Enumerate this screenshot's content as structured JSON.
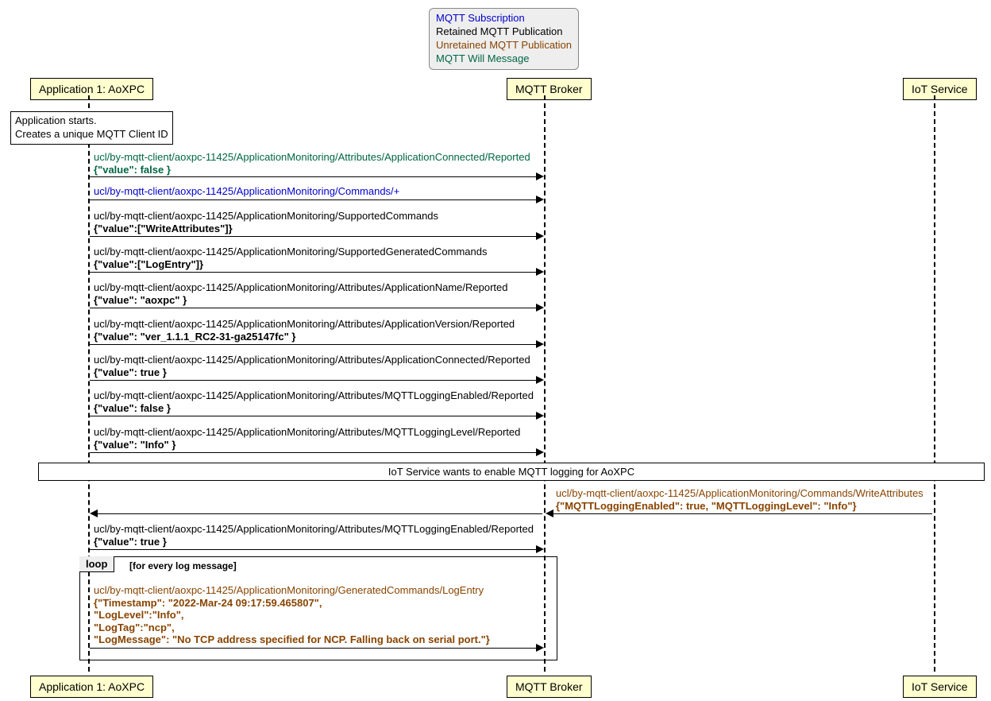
{
  "legend": {
    "sub": "MQTT Subscription",
    "ret": "Retained MQTT Publication",
    "unret": "Unretained MQTT Publication",
    "will": "MQTT Will Message"
  },
  "participants": {
    "app": "Application 1: AoXPC",
    "broker": "MQTT Broker",
    "iot": "IoT Service"
  },
  "note_start": {
    "l1": "Application starts.",
    "l2": "Creates a unique MQTT Client ID"
  },
  "m1": {
    "topic": "ucl/by-mqtt-client/aoxpc-11425/ApplicationMonitoring/Attributes/ApplicationConnected/Reported",
    "payload": "{\"value\": false }"
  },
  "m2": {
    "topic": "ucl/by-mqtt-client/aoxpc-11425/ApplicationMonitoring/Commands/+"
  },
  "m3": {
    "topic": "ucl/by-mqtt-client/aoxpc-11425/ApplicationMonitoring/SupportedCommands",
    "payload": "{\"value\":[\"WriteAttributes\"]}"
  },
  "m4": {
    "topic": "ucl/by-mqtt-client/aoxpc-11425/ApplicationMonitoring/SupportedGeneratedCommands",
    "payload": "{\"value\":[\"LogEntry\"]}"
  },
  "m5": {
    "topic": "ucl/by-mqtt-client/aoxpc-11425/ApplicationMonitoring/Attributes/ApplicationName/Reported",
    "payload": "{\"value\": \"aoxpc\" }"
  },
  "m6": {
    "topic": "ucl/by-mqtt-client/aoxpc-11425/ApplicationMonitoring/Attributes/ApplicationVersion/Reported",
    "payload": "{\"value\": \"ver_1.1.1_RC2-31-ga25147fc\" }"
  },
  "m7": {
    "topic": "ucl/by-mqtt-client/aoxpc-11425/ApplicationMonitoring/Attributes/ApplicationConnected/Reported",
    "payload": "{\"value\": true }"
  },
  "m8": {
    "topic": "ucl/by-mqtt-client/aoxpc-11425/ApplicationMonitoring/Attributes/MQTTLoggingEnabled/Reported",
    "payload": "{\"value\": false }"
  },
  "m9": {
    "topic": "ucl/by-mqtt-client/aoxpc-11425/ApplicationMonitoring/Attributes/MQTTLoggingLevel/Reported",
    "payload": "{\"value\": \"Info\" }"
  },
  "note_mid": "IoT Service wants to enable MQTT logging for AoXPC",
  "m10": {
    "topic": "ucl/by-mqtt-client/aoxpc-11425/ApplicationMonitoring/Commands/WriteAttributes",
    "payload": "{\"MQTTLoggingEnabled\": true, \"MQTTLoggingLevel\": \"Info\"}"
  },
  "m11": {
    "topic": "ucl/by-mqtt-client/aoxpc-11425/ApplicationMonitoring/Attributes/MQTTLoggingEnabled/Reported",
    "payload": "{\"value\": true }"
  },
  "loop": {
    "tag": "loop",
    "cond": "[for every log message]"
  },
  "m12": {
    "topic": "ucl/by-mqtt-client/aoxpc-11425/ApplicationMonitoring/GeneratedCommands/LogEntry",
    "p1": "{\"Timestamp\": \"2022-Mar-24 09:17:59.465807\",",
    "p2": "\"LogLevel\":\"Info\",",
    "p3": "\"LogTag\":\"ncp\",",
    "p4": "\"LogMessage\": \"No TCP address specified for NCP. Falling back on serial port.\"}"
  }
}
